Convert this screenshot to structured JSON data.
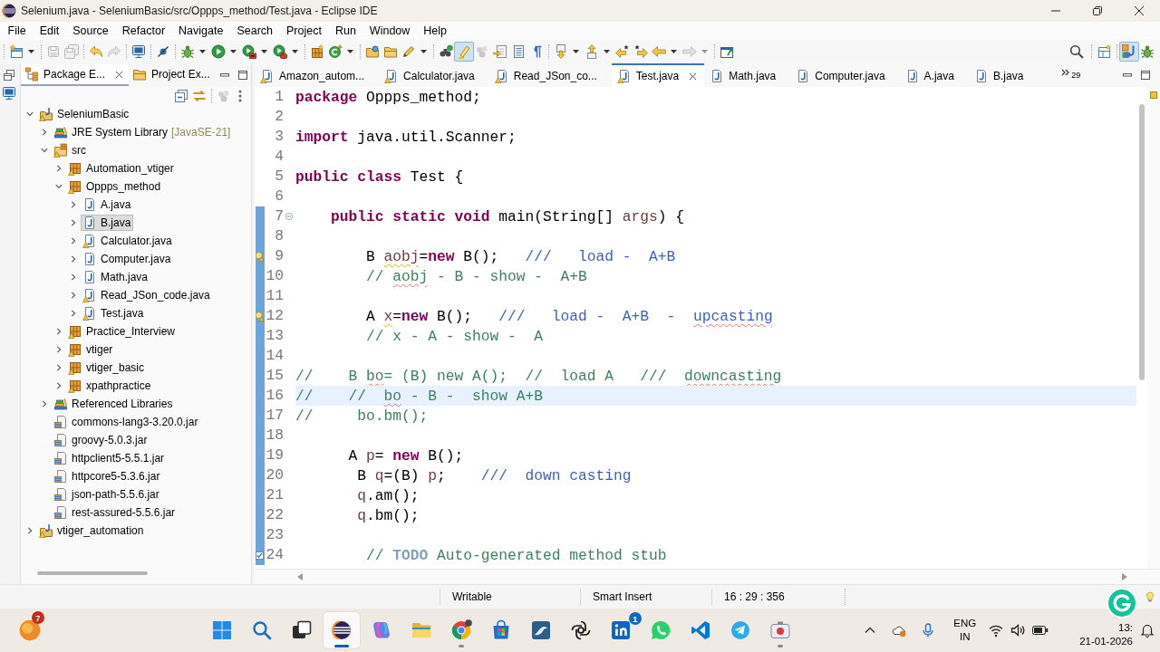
{
  "window": {
    "title": "Selenium.java - SeleniumBasic/src/Oppps_method/Test.java - Eclipse IDE"
  },
  "menu": [
    "File",
    "Edit",
    "Source",
    "Refactor",
    "Navigate",
    "Search",
    "Project",
    "Run",
    "Window",
    "Help"
  ],
  "toolbar": {
    "buttons": [
      {
        "disabled": false,
        "pressed": false
      },
      {
        "disabled": true,
        "pressed": false
      },
      {
        "disabled": true,
        "pressed": false
      },
      {
        "disabled": false,
        "pressed": false
      },
      {
        "disabled": true,
        "pressed": false
      },
      {
        "disabled": false,
        "pressed": false
      },
      {
        "disabled": false,
        "pressed": false
      },
      {
        "disabled": false,
        "pressed": false
      },
      {
        "disabled": false,
        "pressed": false
      },
      {
        "disabled": false,
        "pressed": false
      },
      {
        "disabled": false,
        "pressed": false
      },
      {
        "disabled": false,
        "pressed": false
      },
      {
        "disabled": false,
        "pressed": false
      },
      {
        "disabled": false,
        "pressed": false
      },
      {
        "disabled": false,
        "pressed": false
      },
      {
        "disabled": false,
        "pressed": false
      },
      {
        "disabled": false,
        "pressed": false
      },
      {
        "disabled": false,
        "pressed": true
      },
      {
        "disabled": true,
        "pressed": false
      },
      {
        "disabled": false,
        "pressed": false
      },
      {
        "disabled": false,
        "pressed": false
      },
      {
        "disabled": false,
        "pressed": false
      },
      {
        "disabled": false,
        "pressed": false
      },
      {
        "disabled": false,
        "pressed": false
      },
      {
        "disabled": false,
        "pressed": false
      },
      {
        "disabled": false,
        "pressed": false
      },
      {
        "disabled": false,
        "pressed": false
      },
      {
        "disabled": true,
        "pressed": false
      },
      {
        "disabled": false,
        "pressed": false
      }
    ],
    "perspectives": [
      {
        "selected": true
      },
      {
        "selected": false
      }
    ]
  },
  "package_explorer": {
    "tabs": [
      {
        "label": "Package E...",
        "selected": true
      },
      {
        "label": "Project Ex...",
        "selected": false
      }
    ],
    "tree": [
      {
        "label": "SeleniumBasic",
        "kind": "project",
        "expanded": true,
        "selected": false,
        "warning": true,
        "children": [
          {
            "label": "JRE System Library",
            "decoration": "[JavaSE-21]",
            "kind": "library",
            "expanded": false,
            "selected": false,
            "warning": false
          },
          {
            "label": "src",
            "kind": "source-folder",
            "expanded": true,
            "selected": false,
            "warning": true,
            "children": [
              {
                "label": "Automation_vtiger",
                "kind": "package",
                "expanded": false,
                "selected": false,
                "warning": true
              },
              {
                "label": "Oppps_method",
                "kind": "package",
                "expanded": true,
                "selected": false,
                "warning": true,
                "children": [
                  {
                    "label": "A.java",
                    "kind": "java-file",
                    "expanded": false,
                    "selected": false,
                    "warning": false
                  },
                  {
                    "label": "B.java",
                    "kind": "java-file",
                    "expanded": false,
                    "selected": true,
                    "warning": false
                  },
                  {
                    "label": "Calculator.java",
                    "kind": "java-file",
                    "expanded": false,
                    "selected": false,
                    "warning": true
                  },
                  {
                    "label": "Computer.java",
                    "kind": "java-file",
                    "expanded": false,
                    "selected": false,
                    "warning": false
                  },
                  {
                    "label": "Math.java",
                    "kind": "java-file",
                    "expanded": false,
                    "selected": false,
                    "warning": false
                  },
                  {
                    "label": "Read_JSon_code.java",
                    "kind": "java-file",
                    "expanded": false,
                    "selected": false,
                    "warning": true
                  },
                  {
                    "label": "Test.java",
                    "kind": "java-file",
                    "expanded": false,
                    "selected": false,
                    "warning": true
                  }
                ]
              },
              {
                "label": "Practice_Interview",
                "kind": "package",
                "expanded": false,
                "selected": false,
                "warning": true
              },
              {
                "label": "vtiger",
                "kind": "package",
                "expanded": false,
                "selected": false,
                "warning": true
              },
              {
                "label": "vtiger_basic",
                "kind": "package",
                "expanded": false,
                "selected": false,
                "warning": true
              },
              {
                "label": "xpathpractice",
                "kind": "package",
                "expanded": false,
                "selected": false,
                "warning": true
              }
            ]
          },
          {
            "label": "Referenced Libraries",
            "kind": "library",
            "expanded": false,
            "selected": false,
            "warning": false
          },
          {
            "label": "commons-lang3-3.20.0.jar",
            "kind": "jar",
            "selected": false,
            "warning": false
          },
          {
            "label": "groovy-5.0.3.jar",
            "kind": "jar",
            "selected": false,
            "warning": false
          },
          {
            "label": "httpclient5-5.5.1.jar",
            "kind": "jar",
            "selected": false,
            "warning": false
          },
          {
            "label": "httpcore5-5.3.6.jar",
            "kind": "jar",
            "selected": false,
            "warning": false
          },
          {
            "label": "json-path-5.5.6.jar",
            "kind": "jar",
            "selected": false,
            "warning": false
          },
          {
            "label": "rest-assured-5.5.6.jar",
            "kind": "jar",
            "selected": false,
            "warning": false
          }
        ]
      },
      {
        "label": "vtiger_automation",
        "kind": "project",
        "expanded": false,
        "selected": false,
        "warning": true
      }
    ]
  },
  "editor": {
    "tabs": [
      {
        "label": "Amazon_autom...",
        "selected": false,
        "warning": true
      },
      {
        "label": "Calculator.java",
        "selected": false,
        "warning": true
      },
      {
        "label": "Read_JSon_co...",
        "selected": false,
        "warning": true
      },
      {
        "label": "Test.java",
        "selected": true,
        "warning": true
      },
      {
        "label": "Math.java",
        "selected": false,
        "warning": false
      },
      {
        "label": "Computer.java",
        "selected": false,
        "warning": false
      },
      {
        "label": "A.java",
        "selected": false,
        "warning": false
      },
      {
        "label": "B.java",
        "selected": false,
        "warning": false
      }
    ],
    "overflow_count": "29",
    "lines": [
      {
        "number": "1",
        "in_range": false,
        "current": false,
        "tokens": [
          {
            "kind": "keyword",
            "text": "package"
          },
          {
            "kind": "plain",
            "text": " Oppps_method;"
          }
        ]
      },
      {
        "number": "2",
        "in_range": false,
        "current": false
      },
      {
        "number": "3",
        "in_range": false,
        "current": false,
        "tokens": [
          {
            "kind": "keyword",
            "text": "import"
          },
          {
            "kind": "plain",
            "text": " java.util.Scanner;"
          }
        ]
      },
      {
        "number": "4",
        "in_range": false,
        "current": false
      },
      {
        "number": "5",
        "in_range": false,
        "current": false,
        "tokens": [
          {
            "kind": "keyword",
            "text": "public class"
          },
          {
            "kind": "plain",
            "text": " Test {"
          }
        ]
      },
      {
        "number": "6",
        "in_range": false,
        "current": false
      },
      {
        "number": "7",
        "in_range": true,
        "current": false,
        "marker": {
          "kind": "fold"
        },
        "tokens": [
          {
            "kind": "keyword",
            "text": "    public static void"
          },
          {
            "kind": "plain",
            "text": " main(String[] "
          },
          {
            "kind": "variable",
            "text": "args"
          },
          {
            "kind": "plain",
            "text": ") {"
          }
        ]
      },
      {
        "number": "8",
        "in_range": true,
        "current": false
      },
      {
        "number": "9",
        "in_range": true,
        "current": false,
        "marker": {
          "kind": "warning"
        },
        "tokens": [
          {
            "kind": "plain",
            "text": "        B "
          },
          {
            "kind": "variable",
            "text": "aobj",
            "underline": {
              "kind": "warning"
            }
          },
          {
            "kind": "plain",
            "text": "="
          },
          {
            "kind": "keyword",
            "text": "new"
          },
          {
            "kind": "plain",
            "text": " B();   "
          },
          {
            "kind": "doc",
            "text": "///   load -  A+B"
          }
        ]
      },
      {
        "number": "10",
        "in_range": true,
        "current": false,
        "tokens": [
          {
            "kind": "comment",
            "text": "        // "
          },
          {
            "kind": "comment",
            "text": "aobj",
            "underline": {
              "kind": "spelling"
            }
          },
          {
            "kind": "comment",
            "text": " - B - show -  A+B"
          }
        ]
      },
      {
        "number": "11",
        "in_range": true,
        "current": false
      },
      {
        "number": "12",
        "in_range": true,
        "current": false,
        "marker": {
          "kind": "warning"
        },
        "tokens": [
          {
            "kind": "plain",
            "text": "        A "
          },
          {
            "kind": "variable",
            "text": "x",
            "underline": {
              "kind": "warning"
            }
          },
          {
            "kind": "plain",
            "text": "="
          },
          {
            "kind": "keyword",
            "text": "new"
          },
          {
            "kind": "plain",
            "text": " B();   "
          },
          {
            "kind": "doc",
            "text": "///   load -  A+B  -  "
          },
          {
            "kind": "doc",
            "text": "upcasting",
            "underline": {
              "kind": "spelling"
            }
          }
        ]
      },
      {
        "number": "13",
        "in_range": true,
        "current": false,
        "tokens": [
          {
            "kind": "comment",
            "text": "        // x - A - show -  A"
          }
        ]
      },
      {
        "number": "14",
        "in_range": true,
        "current": false
      },
      {
        "number": "15",
        "in_range": true,
        "current": false,
        "tokens": [
          {
            "kind": "comment",
            "text": "//    B "
          },
          {
            "kind": "comment",
            "text": "bo",
            "underline": {
              "kind": "spelling"
            }
          },
          {
            "kind": "comment",
            "text": "= (B) new A();  //  load A   ///  "
          },
          {
            "kind": "comment",
            "text": "downcasting",
            "underline": {
              "kind": "spelling"
            }
          }
        ]
      },
      {
        "number": "16",
        "in_range": true,
        "current": true,
        "tokens": [
          {
            "kind": "comment",
            "text": "//    //  "
          },
          {
            "kind": "comment",
            "text": "bo",
            "underline": {
              "kind": "spelling"
            }
          },
          {
            "kind": "comment",
            "text": " - B -  show A+B"
          }
        ]
      },
      {
        "number": "17",
        "in_range": true,
        "current": false,
        "tokens": [
          {
            "kind": "comment",
            "text": "//     bo.bm();"
          }
        ]
      },
      {
        "number": "18",
        "in_range": true,
        "current": false
      },
      {
        "number": "19",
        "in_range": true,
        "current": false,
        "tokens": [
          {
            "kind": "plain",
            "text": "      A "
          },
          {
            "kind": "variable",
            "text": "p"
          },
          {
            "kind": "plain",
            "text": "= "
          },
          {
            "kind": "keyword",
            "text": "new"
          },
          {
            "kind": "plain",
            "text": " B();"
          }
        ]
      },
      {
        "number": "20",
        "in_range": true,
        "current": false,
        "tokens": [
          {
            "kind": "plain",
            "text": "       B "
          },
          {
            "kind": "variable",
            "text": "q"
          },
          {
            "kind": "plain",
            "text": "=(B) "
          },
          {
            "kind": "variable",
            "text": "p"
          },
          {
            "kind": "plain",
            "text": ";    "
          },
          {
            "kind": "doc",
            "text": "///  down casting"
          }
        ]
      },
      {
        "number": "21",
        "in_range": true,
        "current": false,
        "tokens": [
          {
            "kind": "variable",
            "text": "       q"
          },
          {
            "kind": "plain",
            "text": ".am();"
          }
        ]
      },
      {
        "number": "22",
        "in_range": true,
        "current": false,
        "tokens": [
          {
            "kind": "variable",
            "text": "       q"
          },
          {
            "kind": "plain",
            "text": ".bm();"
          }
        ]
      },
      {
        "number": "23",
        "in_range": true,
        "current": false
      },
      {
        "number": "24",
        "in_range": true,
        "current": false,
        "marker": {
          "kind": "task"
        },
        "tokens": [
          {
            "kind": "comment",
            "text": "        // "
          },
          {
            "kind": "task",
            "text": "TODO"
          },
          {
            "kind": "comment",
            "text": " Auto-generated method stub"
          }
        ]
      }
    ]
  },
  "status_bar": [
    "Writable",
    "Smart Insert",
    "16 : 29 : 356"
  ],
  "taskbar": {
    "widget_badge": "7",
    "apps": [
      {
        "active": false,
        "running": false
      },
      {
        "active": false,
        "running": false
      },
      {
        "active": false,
        "running": false
      },
      {
        "active": true,
        "running": true
      },
      {
        "active": false,
        "running": false
      },
      {
        "active": false,
        "running": false
      },
      {
        "active": false,
        "running": true
      },
      {
        "active": false,
        "running": false
      },
      {
        "active": false,
        "running": false
      },
      {
        "active": false,
        "running": false
      },
      {
        "active": false,
        "running": false,
        "badge": "1"
      },
      {
        "active": false,
        "running": false
      },
      {
        "active": false,
        "running": false
      },
      {
        "active": false,
        "running": false
      },
      {
        "active": false,
        "running": true
      }
    ],
    "tray": {
      "language": "ENG",
      "region": "IN",
      "time": "13:",
      "date": "21-01-2026"
    }
  }
}
